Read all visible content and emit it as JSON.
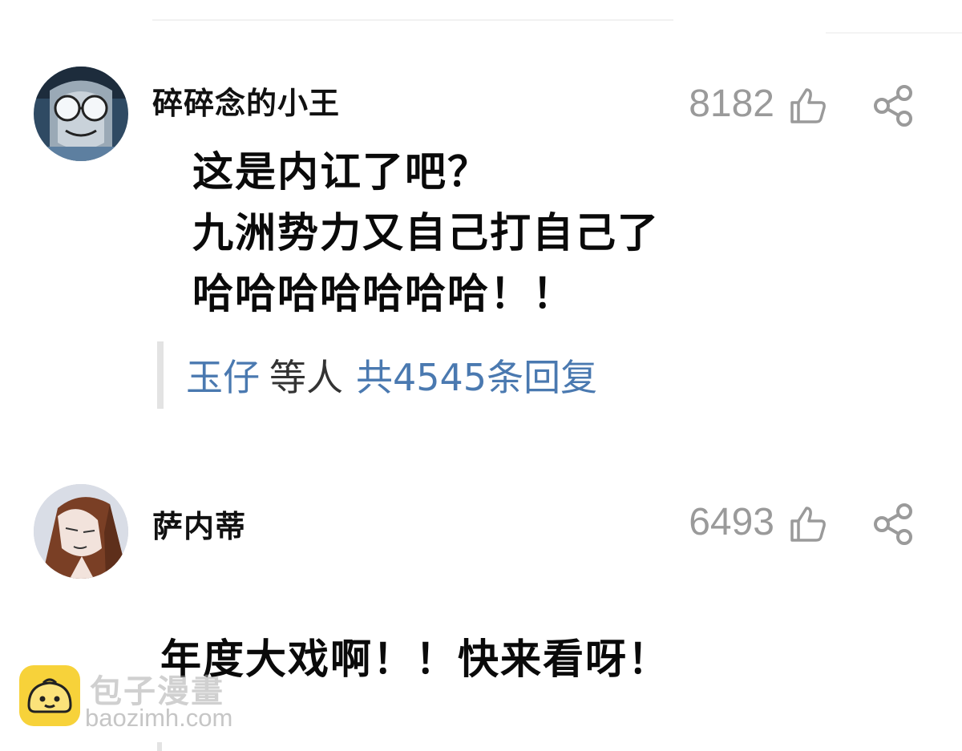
{
  "comments": [
    {
      "username": "碎碎念的小王",
      "likes": "8182",
      "text_lines": [
        "这是内讧了吧？",
        "九洲势力又自己打自己了",
        "哈哈哈哈哈哈哈！！"
      ],
      "replies": {
        "user": "玉仔",
        "middle": "等人",
        "count_text": "共4545条回复"
      }
    },
    {
      "username": "萨内蒂",
      "likes": "6493",
      "text_lines": [
        "年度大戏啊！！快来看呀！"
      ]
    }
  ],
  "watermark": {
    "name": "包子漫畫",
    "url": "baozimh.com"
  },
  "icons": {
    "like": "thumbs-up-icon",
    "share": "share-icon",
    "logo": "bun-logo-icon"
  },
  "colors": {
    "link_blue": "#4a79b0",
    "count_gray": "#9a9a9a",
    "logo_yellow": "#f7d23a"
  }
}
